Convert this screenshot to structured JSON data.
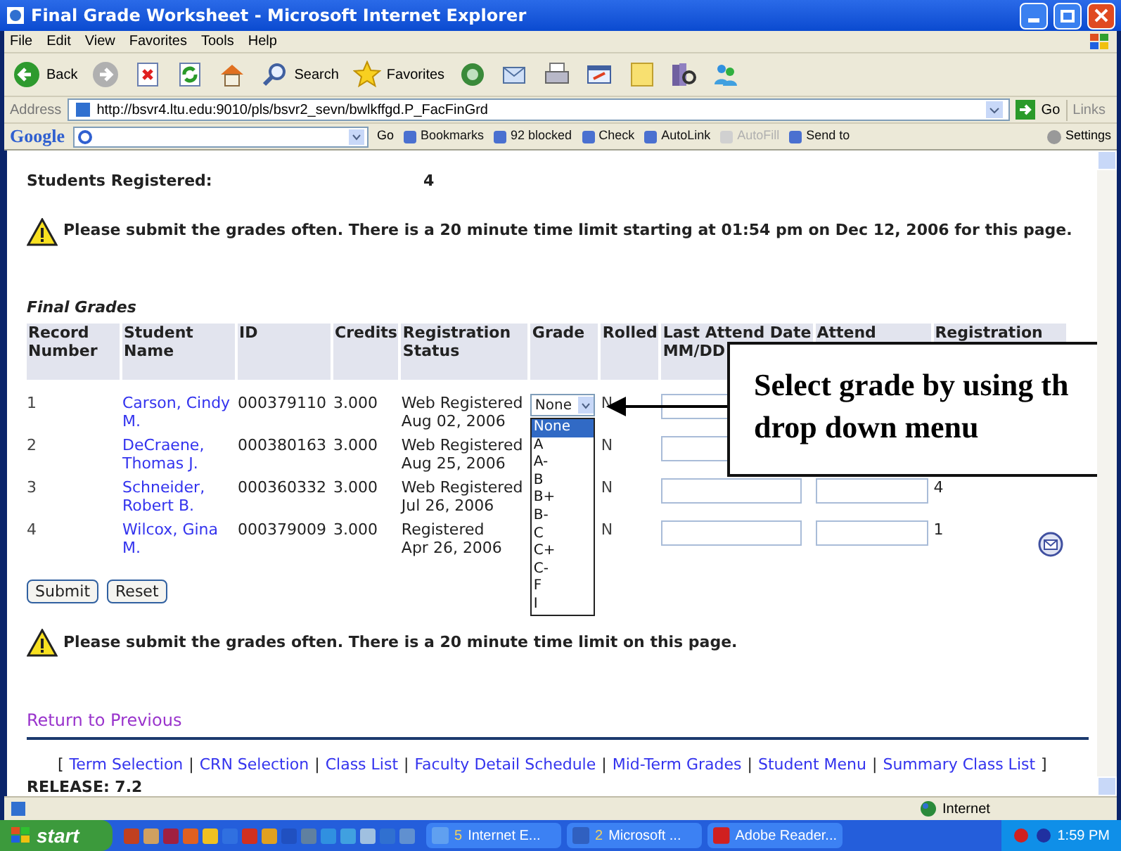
{
  "window": {
    "title": "Final Grade Worksheet - Microsoft Internet Explorer"
  },
  "menu": [
    "File",
    "Edit",
    "View",
    "Favorites",
    "Tools",
    "Help"
  ],
  "toolbar": [
    {
      "kind": "back",
      "label": "Back"
    },
    {
      "kind": "forward"
    },
    {
      "kind": "stop"
    },
    {
      "kind": "refresh"
    },
    {
      "kind": "home"
    },
    {
      "kind": "search",
      "label": "Search"
    },
    {
      "kind": "favorites",
      "label": "Favorites"
    },
    {
      "kind": "media"
    },
    {
      "kind": "mail"
    },
    {
      "kind": "print"
    },
    {
      "kind": "edit"
    },
    {
      "kind": "notes"
    },
    {
      "kind": "research"
    },
    {
      "kind": "messenger"
    }
  ],
  "address": {
    "label": "Address",
    "url": "http://bsvr4.ltu.edu:9010/pls/bsvr2_sevn/bwlkffgd.P_FacFinGrd",
    "go": "Go",
    "links": "Links"
  },
  "google_bar": {
    "logo": "Google",
    "go": "Go",
    "items": [
      {
        "label": "Bookmarks",
        "disabled": false
      },
      {
        "label": "92 blocked",
        "disabled": false
      },
      {
        "label": "Check",
        "disabled": false
      },
      {
        "label": "AutoLink",
        "disabled": false
      },
      {
        "label": "AutoFill",
        "disabled": true
      },
      {
        "label": "Send to",
        "disabled": false
      }
    ],
    "settings": "Settings"
  },
  "page": {
    "students_registered": {
      "label": "Students Registered:",
      "value": "4"
    },
    "warning_top": "Please submit the grades often. There is a 20 minute time limit starting at 01:54 pm on Dec 12, 2006 for this page.",
    "section_title": "Final Grades",
    "columns": [
      [
        "Record",
        "Number"
      ],
      [
        "Student",
        "Name"
      ],
      [
        "ID"
      ],
      [
        "Credits"
      ],
      [
        "Registration",
        "Status"
      ],
      [
        "Grade"
      ],
      [
        "Rolled"
      ],
      [
        "Last Attend Date",
        "MM/DD"
      ],
      [
        "Attend"
      ],
      [
        "Registration"
      ]
    ],
    "rows": [
      {
        "record": "1",
        "name": "Carson, Cindy M.",
        "id": "000379110",
        "credits": "3.000",
        "status": "Web Registered",
        "date": "Aug 02, 2006",
        "rolled": "N"
      },
      {
        "record": "2",
        "name": "DeCraene, Thomas J.",
        "id": "000380163",
        "credits": "3.000",
        "status": "Web Registered",
        "date": "Aug 25, 2006",
        "rolled": "N"
      },
      {
        "record": "3",
        "name": "Schneider, Robert B.",
        "id": "000360332",
        "credits": "3.000",
        "status": "Web Registered",
        "date": "Jul 26, 2006",
        "rolled": "N",
        "hours": "4"
      },
      {
        "record": "4",
        "name": "Wilcox, Gina M.",
        "id": "000379009",
        "credits": "3.000",
        "status": "Registered",
        "date": "Apr 26, 2006",
        "rolled": "N",
        "hours": "1",
        "mail": true
      }
    ],
    "grade_select": {
      "value": "None",
      "options": [
        {
          "label": "None",
          "selected": true
        },
        {
          "label": "A",
          "selected": false
        },
        {
          "label": "A-",
          "selected": false
        },
        {
          "label": "B",
          "selected": false
        },
        {
          "label": "B+",
          "selected": false
        },
        {
          "label": "B-",
          "selected": false
        },
        {
          "label": "C",
          "selected": false
        },
        {
          "label": "C+",
          "selected": false
        },
        {
          "label": "C-",
          "selected": false
        },
        {
          "label": "F",
          "selected": false
        },
        {
          "label": "I",
          "selected": false
        }
      ]
    },
    "buttons": [
      "Submit",
      "Reset"
    ],
    "warning_bottom": "Please submit the grades often. There is a 20 minute time limit on this page.",
    "return_link": "Return to Previous",
    "nav_links": [
      "Term Selection",
      "CRN Selection",
      "Class List",
      "Faculty Detail Schedule",
      "Mid-Term Grades",
      "Student Menu",
      "Summary Class List"
    ],
    "nav_open": "[",
    "nav_close": "]",
    "nav_sep": "|",
    "release": "RELEASE: 7.2"
  },
  "callout": {
    "lines": [
      "Select grade by using th",
      "drop down menu"
    ]
  },
  "status_bar": {
    "zone": "Internet"
  },
  "taskbar": {
    "start": "start",
    "tasks": [
      {
        "count": "5",
        "label": "Internet E..."
      },
      {
        "count": "2",
        "label": "Microsoft ..."
      },
      {
        "label": "Adobe Reader..."
      }
    ],
    "clock": "1:59 PM"
  }
}
